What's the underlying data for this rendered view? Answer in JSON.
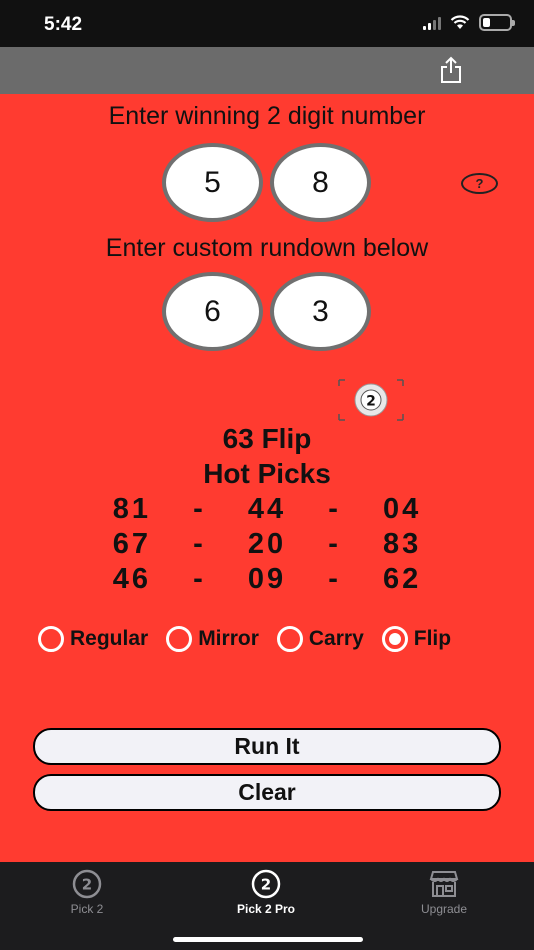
{
  "status": {
    "time": "5:42"
  },
  "winning": {
    "label": "Enter winning 2 digit number",
    "digit1": "5",
    "digit2": "8",
    "help": "?"
  },
  "rundown": {
    "label": "Enter custom rundown below",
    "digit1": "6",
    "digit2": "3"
  },
  "result": {
    "title": "63 Flip",
    "subtitle": "Hot Picks",
    "rows": [
      "81  -  44  -  04",
      "67  -  20  -  83",
      "46  -  09  -  62"
    ]
  },
  "modes": [
    {
      "label": "Regular",
      "selected": false
    },
    {
      "label": "Mirror",
      "selected": false
    },
    {
      "label": "Carry",
      "selected": false
    },
    {
      "label": "Flip",
      "selected": true
    }
  ],
  "buttons": {
    "run": "Run It",
    "clear": "Clear"
  },
  "tabs": [
    {
      "label": "Pick 2",
      "glyph": "2",
      "active": false
    },
    {
      "label": "Pick 2 Pro",
      "glyph": "2",
      "active": true
    },
    {
      "label": "Upgrade",
      "active": false
    }
  ],
  "ball_icon": {
    "glyph": "2"
  },
  "colors": {
    "background": "#ff3b30",
    "nav": "#6b6b6b",
    "tabbar": "#1c1c1e",
    "active_tab": "#ffffff",
    "inactive_tab": "#8e8e93"
  }
}
